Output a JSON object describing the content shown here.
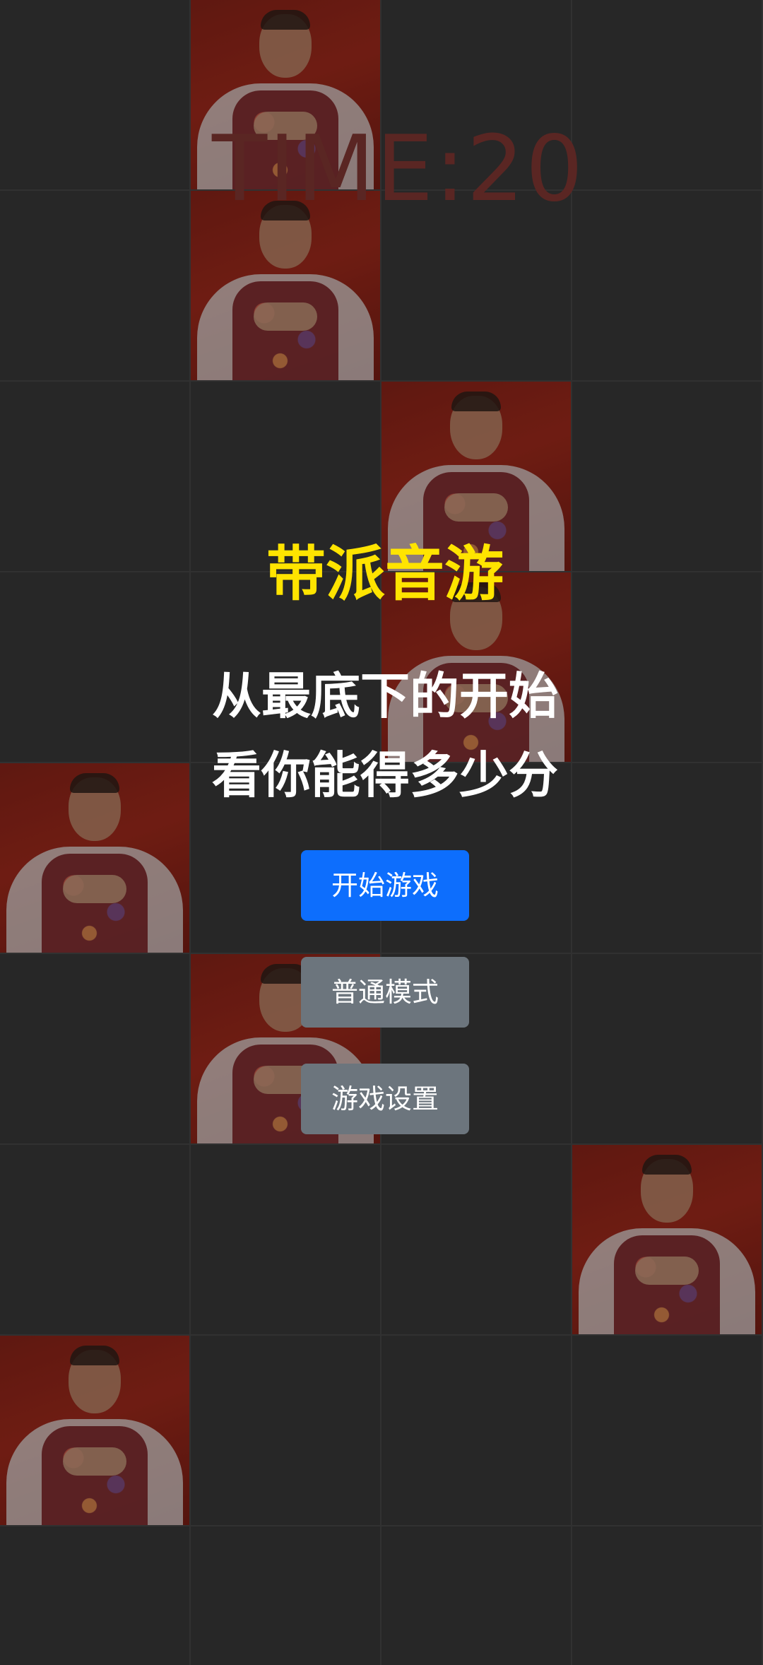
{
  "game": {
    "timer": "TIME:20",
    "columns": 4,
    "rows": 10,
    "active_tiles": [
      {
        "row": 0,
        "col": 1
      },
      {
        "row": 1,
        "col": 1
      },
      {
        "row": 2,
        "col": 2
      },
      {
        "row": 3,
        "col": 2
      },
      {
        "row": 4,
        "col": 0
      },
      {
        "row": 5,
        "col": 1
      },
      {
        "row": 6,
        "col": 3
      },
      {
        "row": 7,
        "col": 0
      }
    ],
    "tile_image": "man-portrait"
  },
  "menu": {
    "title": "带派音游",
    "subtitle_line1": "从最底下的开始",
    "subtitle_line2": "看你能得多少分",
    "start_button": "开始游戏",
    "mode_button": "普通模式",
    "settings_button": "游戏设置"
  },
  "colors": {
    "title": "#ffe400",
    "primary_button": "#0d6efd",
    "secondary_button": "#6c757d",
    "timer": "#5a2623",
    "background": "#333333"
  }
}
